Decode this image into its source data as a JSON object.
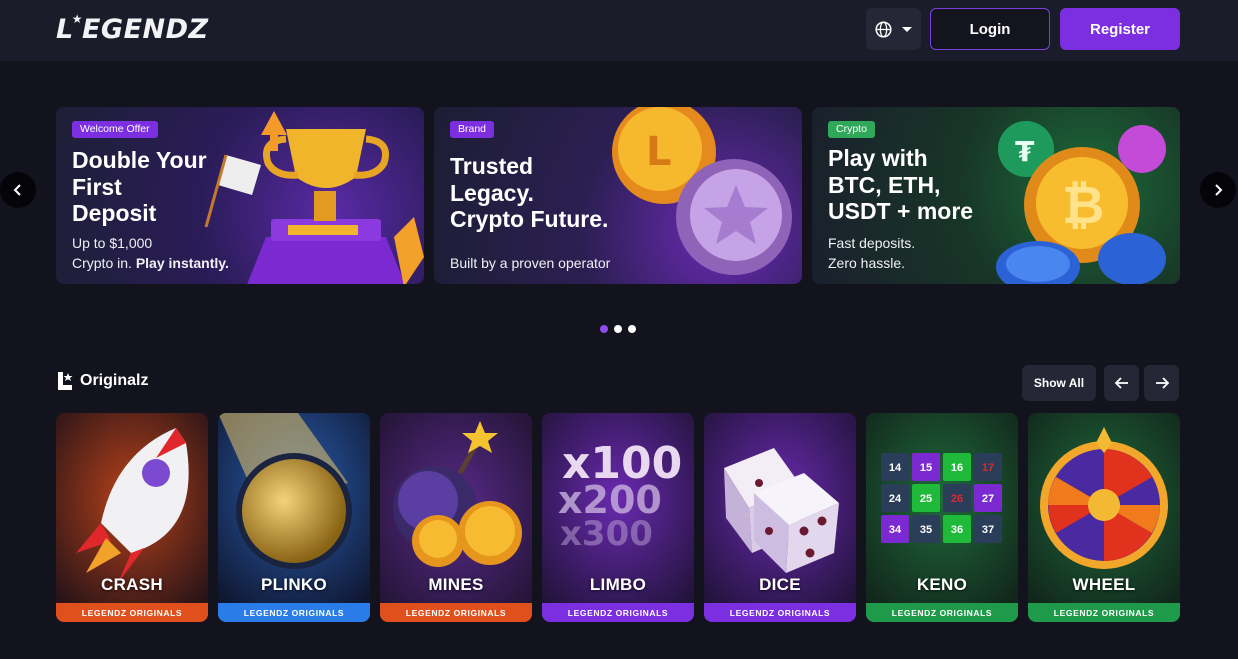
{
  "header": {
    "logo_text": "LEGENDZ",
    "language_icon": "globe-icon",
    "login_label": "Login",
    "register_label": "Register",
    "accent_color": "#7b2fe0"
  },
  "carousel": {
    "banners": [
      {
        "tag": "Welcome Offer",
        "tag_color": "#7b2fe0",
        "title": "Double Your\nFirst\nDeposit",
        "sub_line1": "Up to $1,000",
        "sub_line2_plain": "Crypto in. ",
        "sub_line2_bold": "Play instantly."
      },
      {
        "tag": "Brand",
        "tag_color": "#7b2fe0",
        "title": "Trusted\nLegacy.\nCrypto Future.",
        "sub_line1": "Built by a proven operator"
      },
      {
        "tag": "Crypto",
        "tag_color": "#2fa85a",
        "title": "Play with\nBTC, ETH,\nUSDT + more",
        "sub_line1": "Fast deposits.",
        "sub_line2": "Zero hassle."
      }
    ],
    "active_slide": 1,
    "slide_count": 3
  },
  "originals": {
    "title": "Originalz",
    "show_all_label": "Show All",
    "games": [
      {
        "name": "CRASH",
        "label": "LEGENDZ ORIGINALS",
        "strip_color": "#e0501c"
      },
      {
        "name": "PLINKO",
        "label": "LEGENDZ ORIGINALS",
        "strip_color": "#2a7de8"
      },
      {
        "name": "MINES",
        "label": "LEGENDZ ORIGINALS",
        "strip_color": "#e0501c"
      },
      {
        "name": "LIMBO",
        "label": "LEGENDZ ORIGINALS",
        "strip_color": "#7b2fe0"
      },
      {
        "name": "DICE",
        "label": "LEGENDZ ORIGINALS",
        "strip_color": "#7b2fe0"
      },
      {
        "name": "KENO",
        "label": "LEGENDZ ORIGINALS",
        "strip_color": "#1f9a4a"
      },
      {
        "name": "WHEEL",
        "label": "LEGENDZ ORIGINALS",
        "strip_color": "#1f9a4a"
      }
    ],
    "keno_numbers": [
      "14",
      "15",
      "16",
      "17",
      "24",
      "25",
      "26",
      "27",
      "34",
      "35",
      "36",
      "37"
    ],
    "limbo_multipliers": [
      "x100",
      "x200",
      "x300"
    ]
  }
}
